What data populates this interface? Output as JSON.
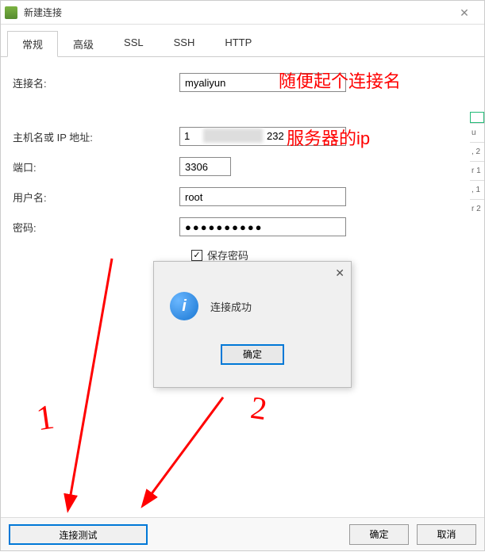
{
  "window": {
    "title": "新建连接"
  },
  "tabs": {
    "general": "常规",
    "advanced": "高级",
    "ssl": "SSL",
    "ssh": "SSH",
    "http": "HTTP"
  },
  "form": {
    "conn_label": "连接名:",
    "conn_value": "myaliyun",
    "host_label": "主机名或 IP 地址:",
    "host_value_prefix": "1",
    "host_value_suffix": "232",
    "port_label": "端口:",
    "port_value": "3306",
    "user_label": "用户名:",
    "user_value": "root",
    "pass_label": "密码:",
    "pass_value": "●●●●●●●●●●",
    "save_pass_label": "保存密码",
    "save_pass_checked": "✓"
  },
  "annotations": {
    "conn_hint": "随便起个连接名",
    "host_hint": "服务器的ip",
    "mark_1": "1",
    "mark_2": "2"
  },
  "popup": {
    "icon_text": "i",
    "message": "连接成功",
    "ok": "确定"
  },
  "buttons": {
    "test": "连接测试",
    "ok": "确定",
    "cancel": "取消"
  },
  "side": {
    "i1": "u",
    "i2": ", 2",
    "i3": "r 1",
    "i4": ", 1",
    "i5": "r 2"
  }
}
